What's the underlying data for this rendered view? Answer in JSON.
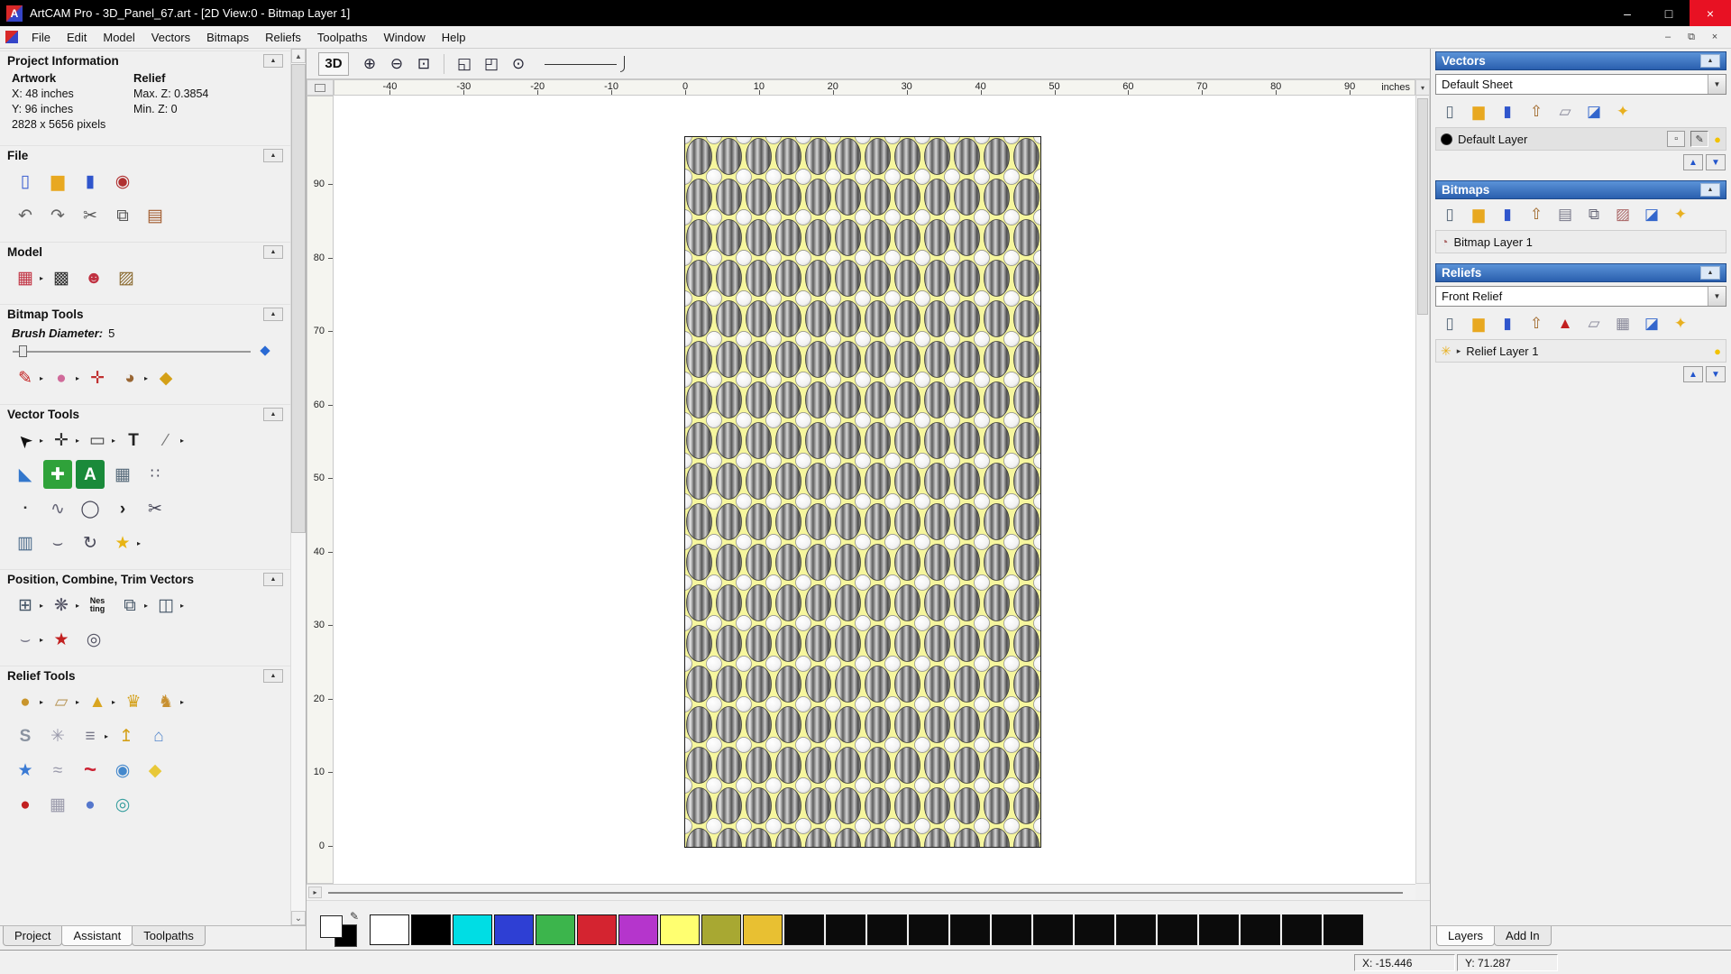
{
  "window": {
    "title": "ArtCAM Pro - 3D_Panel_67.art - [2D View:0 - Bitmap Layer 1]",
    "minimize": "–",
    "maximize": "□",
    "close": "×"
  },
  "menubar": {
    "items": [
      "File",
      "Edit",
      "Model",
      "Vectors",
      "Bitmaps",
      "Reliefs",
      "Toolpaths",
      "Window",
      "Help"
    ],
    "mdi": {
      "minimize": "–",
      "restore": "⧉",
      "close": "×"
    }
  },
  "left": {
    "project_info": {
      "title": "Project Information",
      "artwork": "Artwork",
      "relief": "Relief",
      "x": "X: 48 inches",
      "y": "Y: 96 inches",
      "pixels": "2828 x 5656 pixels",
      "max_z": "Max. Z: 0.3854",
      "min_z": "Min. Z: 0"
    },
    "file": {
      "title": "File",
      "row1": [
        {
          "n": "new-model-icon",
          "g": "▯",
          "c": "#3b5fd0"
        },
        {
          "n": "open-model-icon",
          "g": "▆",
          "c": "#e8a820"
        },
        {
          "n": "save-model-icon",
          "g": "▮",
          "c": "#2f55cc"
        },
        {
          "n": "import-export-icon",
          "g": "◉",
          "c": "#b03030"
        }
      ],
      "row2": [
        {
          "n": "undo-icon",
          "g": "↶",
          "c": "#666"
        },
        {
          "n": "redo-icon",
          "g": "↷",
          "c": "#666"
        },
        {
          "n": "cut-icon",
          "g": "✂",
          "c": "#555"
        },
        {
          "n": "copy-icon",
          "g": "⧉",
          "c": "#555"
        },
        {
          "n": "paste-icon",
          "g": "▤",
          "c": "#a05a2c"
        }
      ]
    },
    "model": {
      "title": "Model",
      "row1": [
        {
          "n": "load-relief-icon",
          "g": "▦",
          "c": "#c03040",
          "a": true
        },
        {
          "n": "greyscale-model-icon",
          "g": "▩",
          "c": "#333"
        },
        {
          "n": "face-wizard-icon",
          "g": "☻",
          "c": "#c03040"
        },
        {
          "n": "load-image-icon",
          "g": "▨",
          "c": "#8a6a30"
        }
      ]
    },
    "bitmap_tools": {
      "title": "Bitmap Tools",
      "brush_label": "Brush Diameter:",
      "brush_value": "5",
      "row1": [
        {
          "n": "paint-icon",
          "g": "✎",
          "c": "#c22020",
          "a": true
        },
        {
          "n": "airbrush-icon",
          "g": "●",
          "c": "#d06a9a",
          "a": true
        },
        {
          "n": "pin-icon",
          "g": "✛",
          "c": "#c03030"
        },
        {
          "n": "palette-icon",
          "g": "◕",
          "c": "#996633",
          "a": true
        },
        {
          "n": "flood-fill-icon",
          "g": "◆",
          "c": "#d4a017"
        }
      ]
    },
    "vector_tools": {
      "title": "Vector Tools",
      "rows": [
        [
          {
            "n": "select-vectors-icon",
            "g": "➤",
            "c": "#111",
            "rot": -135,
            "a": true
          },
          {
            "n": "transform-vectors-icon",
            "g": "✛",
            "c": "#333",
            "a": true
          },
          {
            "n": "create-rectangle-icon",
            "g": "▭",
            "c": "#444",
            "a": true
          },
          {
            "n": "create-text-icon",
            "g": "T",
            "c": "#222",
            "bold": true
          },
          {
            "n": "measure-icon",
            "g": "∕",
            "c": "#777",
            "a": true
          }
        ],
        [
          {
            "n": "vector-doctor-icon",
            "g": "◣",
            "c": "#3377cc"
          },
          {
            "n": "paste-along-curve-icon",
            "g": "✚",
            "c": "#ffffff",
            "b": "#2fa23a"
          },
          {
            "n": "text-on-curve-icon",
            "g": "A",
            "c": "#ffffff",
            "b": "#1a8a3a",
            "bold": true
          },
          {
            "n": "paste-in-view-icon",
            "g": "▦",
            "c": "#566a7a"
          },
          {
            "n": "block-array-icon",
            "g": "∷",
            "c": "#445",
            "fs": 16
          }
        ],
        [
          {
            "n": "node-editing-icon",
            "g": "▪",
            "c": "#333",
            "fs": 10
          },
          {
            "n": "free-polyline-icon",
            "g": "∿",
            "c": "#667"
          },
          {
            "n": "create-circle-icon",
            "g": "◯",
            "c": "#445"
          },
          {
            "n": "create-polyline-icon",
            "g": "›",
            "c": "#222",
            "bold": true
          },
          {
            "n": "trim-vectors-icon",
            "g": "✂",
            "c": "#445"
          }
        ],
        [
          {
            "n": "extrude-vector-icon",
            "g": "▥",
            "c": "#4a6a8a"
          },
          {
            "n": "fit-curve-icon",
            "g": "⌣",
            "c": "#556"
          },
          {
            "n": "mirror-vectors-icon",
            "g": "↻",
            "c": "#445"
          },
          {
            "n": "create-star-icon",
            "g": "★",
            "c": "#e8b413",
            "a": true
          }
        ]
      ]
    },
    "position_tools": {
      "title": "Position, Combine, Trim Vectors",
      "rows": [
        [
          {
            "n": "align-objects-icon",
            "g": "⊞",
            "c": "#456",
            "a": true
          },
          {
            "n": "circular-array-icon",
            "g": "❋",
            "c": "#556",
            "a": true
          },
          {
            "n": "nesting-icon",
            "g": "Nes\nting",
            "c": "#111",
            "fs": 9,
            "bold": true
          },
          {
            "n": "group-vectors-icon",
            "g": "⧉",
            "c": "#456",
            "a": true
          },
          {
            "n": "weld-vectors-icon",
            "g": "◫",
            "c": "#456",
            "a": true
          }
        ],
        [
          {
            "n": "fit-arcs-icon",
            "g": "⌣",
            "c": "#778",
            "a": true
          },
          {
            "n": "vector-stamp-icon",
            "g": "★",
            "c": "#c22020"
          },
          {
            "n": "spiral-icon",
            "g": "◎",
            "c": "#556"
          }
        ]
      ]
    },
    "relief_tools": {
      "title": "Relief Tools",
      "rows": [
        [
          {
            "n": "sculpt-icon",
            "g": "●",
            "c": "#c9952c",
            "a": true
          },
          {
            "n": "smooth-relief-icon",
            "g": "▱",
            "c": "#b9975a",
            "a": true
          },
          {
            "n": "relief-fan-icon",
            "g": "▲",
            "c": "#d9a520",
            "a": true
          },
          {
            "n": "crown-relief-icon",
            "g": "♛",
            "c": "#d4a017"
          },
          {
            "n": "creature-relief-icon",
            "g": "♞",
            "c": "#c89030",
            "a": true
          }
        ],
        [
          {
            "n": "smart-engrave-icon",
            "g": "S",
            "c": "#8a93a0",
            "bold": true
          },
          {
            "n": "weave-wizard-icon",
            "g": "✳",
            "c": "#99a"
          },
          {
            "n": "offset-relief-icon",
            "g": "≡",
            "c": "#778",
            "a": true
          },
          {
            "n": "interactive-sculpt-icon",
            "g": "↥",
            "c": "#d4a017"
          },
          {
            "n": "relief-lamp-icon",
            "g": "⌂",
            "c": "#5588cc"
          }
        ],
        [
          {
            "n": "star-relief-icon",
            "g": "★",
            "c": "#3a7ad4"
          },
          {
            "n": "texture-swirl-icon",
            "g": "≈",
            "c": "#99a"
          },
          {
            "n": "swept-profile-icon",
            "g": "~",
            "c": "#c23",
            "fs": 24,
            "bold": true
          },
          {
            "n": "texture-sphere-icon",
            "g": "◉",
            "c": "#4488cc"
          },
          {
            "n": "relief-plane-icon",
            "g": "◆",
            "c": "#e8c838"
          }
        ],
        [
          {
            "n": "dot-relief-icon",
            "g": "●",
            "c": "#c22020"
          },
          {
            "n": "mesh-relief-icon",
            "g": "▦",
            "c": "#99a"
          },
          {
            "n": "sphere-relief-icon",
            "g": "●",
            "c": "#5577cc"
          },
          {
            "n": "swirl-relief-icon",
            "g": "◎",
            "c": "#3aa0a0"
          }
        ]
      ]
    },
    "tabs": [
      {
        "label": "Project"
      },
      {
        "label": "Assistant",
        "active": true
      },
      {
        "label": "Toolpaths"
      }
    ]
  },
  "canvas": {
    "toolbar1": [
      {
        "n": "view-3d-button",
        "g": "3D",
        "fs": 15,
        "bold": true,
        "c": "#111"
      }
    ],
    "toolbar2": [
      {
        "n": "zoom-in-icon",
        "g": "⊕",
        "c": "#223"
      },
      {
        "n": "zoom-out-icon",
        "g": "⊖",
        "c": "#223"
      },
      {
        "n": "zoom-box-icon",
        "g": "⊡",
        "c": "#223"
      }
    ],
    "toolbar3": [
      {
        "n": "zoom-page-icon",
        "g": "◱",
        "c": "#223"
      },
      {
        "n": "zoom-fit-icon",
        "g": "◰",
        "c": "#223"
      },
      {
        "n": "zoom-objects-icon",
        "g": "⊙",
        "c": "#223"
      }
    ],
    "hruler": {
      "ticks": [
        -40,
        -30,
        -20,
        -10,
        0,
        10,
        20,
        30,
        40,
        50,
        60,
        70,
        80,
        90
      ],
      "unit": "inches"
    },
    "vruler": {
      "ticks": [
        90,
        80,
        70,
        60,
        50,
        40,
        30,
        20,
        10,
        0
      ]
    }
  },
  "right": {
    "vectors": {
      "title": "Vectors",
      "sheet": "Default Sheet",
      "toolbar": [
        {
          "n": "new-sheet-icon",
          "g": "▯",
          "c": "#567"
        },
        {
          "n": "open-sheet-icon",
          "g": "▆",
          "c": "#e8a820"
        },
        {
          "n": "save-sheet-icon",
          "g": "▮",
          "c": "#2f55cc"
        },
        {
          "n": "import-vectors-icon",
          "g": "⇧",
          "c": "#a0682a"
        },
        {
          "n": "export-vectors-icon",
          "g": "▱",
          "c": "#889"
        },
        {
          "n": "delete-vector-layer-icon",
          "g": "◪",
          "c": "#3366cc"
        },
        {
          "n": "merge-vector-layers-icon",
          "g": "✦",
          "c": "#e8b020"
        }
      ],
      "layer": {
        "name": "Default Layer"
      }
    },
    "bitmaps": {
      "title": "Bitmaps",
      "toolbar": [
        {
          "n": "new-bitmap-layer-icon",
          "g": "▯",
          "c": "#567"
        },
        {
          "n": "open-bitmap-icon",
          "g": "▆",
          "c": "#e8a820"
        },
        {
          "n": "save-bitmap-icon",
          "g": "▮",
          "c": "#2f55cc"
        },
        {
          "n": "import-bitmap-icon",
          "g": "⇧",
          "c": "#a0682a"
        },
        {
          "n": "adjust-bitmap-icon",
          "g": "▤",
          "c": "#778"
        },
        {
          "n": "merge-bitmap-icon",
          "g": "⧉",
          "c": "#667"
        },
        {
          "n": "preview-bitmap-icon",
          "g": "▨",
          "c": "#a66"
        },
        {
          "n": "delete-bitmap-layer-icon",
          "g": "◪",
          "c": "#3366cc"
        },
        {
          "n": "combine-bitmap-icon",
          "g": "✦",
          "c": "#e8b020"
        }
      ],
      "layer": {
        "name": "Bitmap Layer 1"
      }
    },
    "reliefs": {
      "title": "Reliefs",
      "relief": "Front Relief",
      "toolbar": [
        {
          "n": "new-relief-layer-icon",
          "g": "▯",
          "c": "#567"
        },
        {
          "n": "open-relief-icon",
          "g": "▆",
          "c": "#e8a820"
        },
        {
          "n": "save-relief-icon",
          "g": "▮",
          "c": "#2f55cc"
        },
        {
          "n": "import-relief-icon",
          "g": "⇧",
          "c": "#a0682a"
        },
        {
          "n": "calculate-relief-icon",
          "g": "▲",
          "c": "#c22020"
        },
        {
          "n": "relief-sheet-icon",
          "g": "▱",
          "c": "#889"
        },
        {
          "n": "relief-grid-icon",
          "g": "▦",
          "c": "#889"
        },
        {
          "n": "delete-relief-layer-icon",
          "g": "◪",
          "c": "#3366cc"
        },
        {
          "n": "merge-relief-layers-icon",
          "g": "✦",
          "c": "#e8b020"
        }
      ],
      "layer": {
        "name": "Relief Layer 1"
      }
    },
    "tabs": [
      {
        "label": "Layers",
        "active": true
      },
      {
        "label": "Add In"
      }
    ]
  },
  "palette": {
    "swatches": [
      "#ffffff",
      "#000000",
      "#00dde4",
      "#2e3fd4",
      "#3cb54c",
      "#d42430",
      "#b535cc",
      "#ffff70",
      "#a8a832",
      "#e8c032",
      "#0b0b0b",
      "#0b0b0b",
      "#0b0b0b",
      "#0b0b0b",
      "#0b0b0b",
      "#0b0b0b",
      "#0b0b0b",
      "#0b0b0b",
      "#0b0b0b",
      "#0b0b0b",
      "#0b0b0b",
      "#0b0b0b",
      "#0b0b0b",
      "#0b0b0b"
    ]
  },
  "status": {
    "x": "X: -15.446",
    "y": "Y: 71.287"
  }
}
